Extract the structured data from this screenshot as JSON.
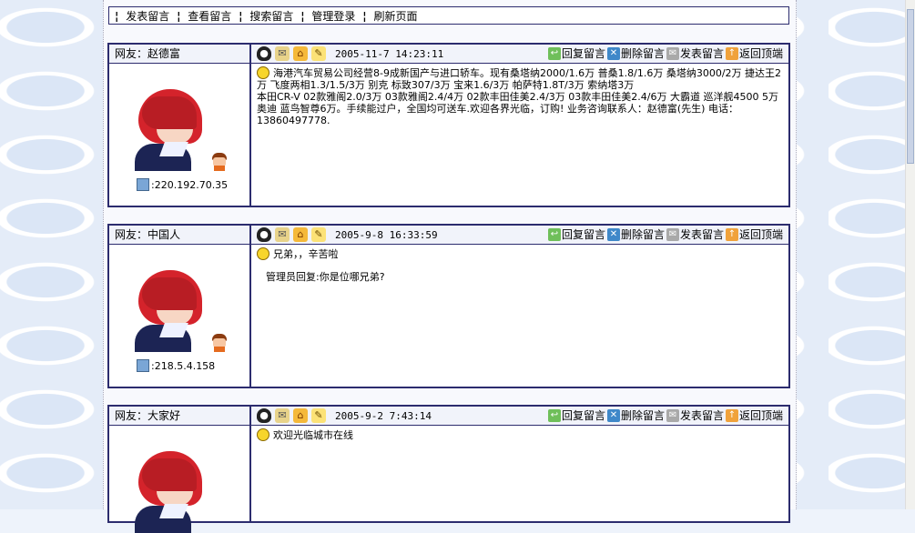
{
  "nav": {
    "items": [
      "发表留言",
      "查看留言",
      "搜索留言",
      "管理登录",
      "刷新页面"
    ],
    "separator": "¦"
  },
  "actions": {
    "reply": "回复留言",
    "delete": "删除留言",
    "post": "发表留言",
    "top": "返回顶端"
  },
  "posts": [
    {
      "name": "网友：赵德富",
      "date": "2005-11-7 14:23:11",
      "ip": ":220.192.70.35",
      "message": "海港汽车贸易公司经营8-9成新国产与进口轿车。现有桑塔纳2000/1.6万 普桑1.8/1.6万 桑塔纳3000/2万 捷达王2万 飞度两相1.3/1.5/3万 别克 标致307/3万 宝来1.6/3万 帕萨特1.8T/3万 索纳塔3万",
      "message2": "本田CR-V 02款雅阁2.0/3万 03款雅阁2.4/4万 02款丰田佳美2.4/3万 03款丰田佳美2.4/6万 大霸道 巡洋舰4500 5万 奥迪 蓝鸟智尊6万。手续能过户，全国均可送车.欢迎各界光临，订购! 业务咨询联系人：赵德富(先生) 电话：13860497778."
    },
    {
      "name": "网友：中国人",
      "date": "2005-9-8 16:33:59",
      "ip": ":218.5.4.158",
      "message": "兄弟，，辛苦啦",
      "reply": "管理员回复:你是位哪兄弟?"
    },
    {
      "name": "网友：大家好",
      "date": "2005-9-2 7:43:14",
      "message": "欢迎光临城市在线"
    }
  ]
}
